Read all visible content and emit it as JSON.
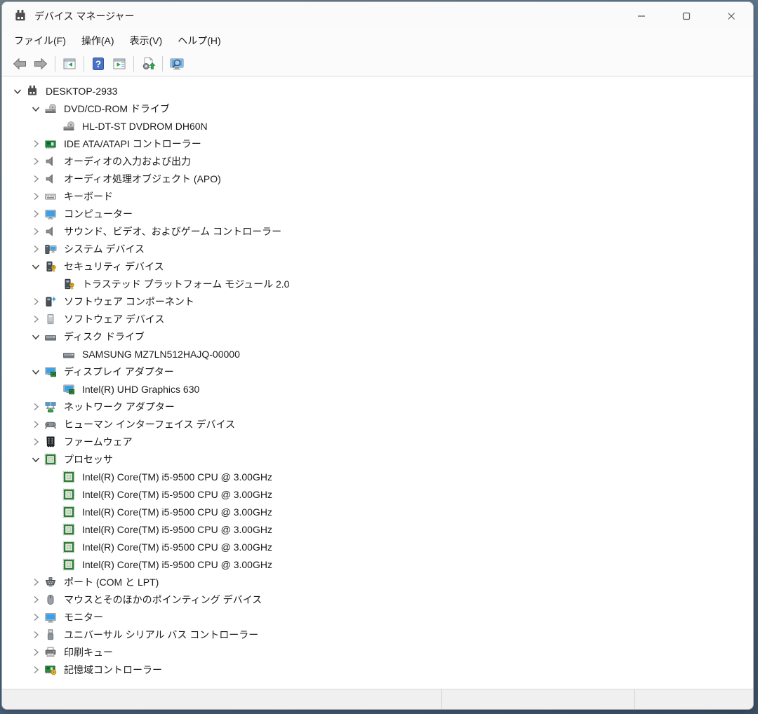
{
  "window": {
    "title": "デバイス マネージャー"
  },
  "menu": {
    "items": [
      {
        "name": "file",
        "label": "ファイル(F)"
      },
      {
        "name": "action",
        "label": "操作(A)"
      },
      {
        "name": "view",
        "label": "表示(V)"
      },
      {
        "name": "help",
        "label": "ヘルプ(H)"
      }
    ]
  },
  "toolbar": {
    "groups": [
      {
        "buttons": [
          {
            "name": "back",
            "icon": "back-icon"
          },
          {
            "name": "forward",
            "icon": "forward-icon"
          }
        ]
      },
      {
        "buttons": [
          {
            "name": "show-hide-console-tree",
            "icon": "console-tree-icon"
          }
        ]
      },
      {
        "buttons": [
          {
            "name": "help",
            "icon": "help-icon"
          },
          {
            "name": "show-hide-action-pane",
            "icon": "action-pane-icon"
          }
        ]
      },
      {
        "buttons": [
          {
            "name": "scan-hardware-changes",
            "icon": "scan-hardware-icon"
          }
        ]
      },
      {
        "buttons": [
          {
            "name": "search-devices",
            "icon": "search-devices-icon"
          }
        ]
      }
    ]
  },
  "tree": {
    "items": [
      {
        "level": 0,
        "state": "expanded",
        "icon": "computer-icon",
        "label": "DESKTOP-2933"
      },
      {
        "level": 1,
        "state": "expanded",
        "icon": "dvd-drive-icon",
        "label": "DVD/CD-ROM ドライブ"
      },
      {
        "level": 2,
        "state": "leaf",
        "icon": "dvd-drive-icon",
        "label": "HL-DT-ST DVDROM DH60N"
      },
      {
        "level": 1,
        "state": "collapsed",
        "icon": "ide-controller-icon",
        "label": "IDE ATA/ATAPI コントローラー"
      },
      {
        "level": 1,
        "state": "collapsed",
        "icon": "audio-icon",
        "label": "オーディオの入力および出力"
      },
      {
        "level": 1,
        "state": "collapsed",
        "icon": "audio-icon",
        "label": "オーディオ処理オブジェクト (APO)"
      },
      {
        "level": 1,
        "state": "collapsed",
        "icon": "keyboard-icon",
        "label": "キーボード"
      },
      {
        "level": 1,
        "state": "collapsed",
        "icon": "monitor-icon",
        "label": "コンピューター"
      },
      {
        "level": 1,
        "state": "collapsed",
        "icon": "audio-icon",
        "label": "サウンド、ビデオ、およびゲーム コントローラー"
      },
      {
        "level": 1,
        "state": "collapsed",
        "icon": "system-devices-icon",
        "label": "システム デバイス"
      },
      {
        "level": 1,
        "state": "expanded",
        "icon": "security-icon",
        "label": "セキュリティ デバイス"
      },
      {
        "level": 2,
        "state": "leaf",
        "icon": "security-icon",
        "label": "トラステッド プラットフォーム モジュール 2.0"
      },
      {
        "level": 1,
        "state": "collapsed",
        "icon": "software-component-icon",
        "label": "ソフトウェア コンポーネント"
      },
      {
        "level": 1,
        "state": "collapsed",
        "icon": "software-device-icon",
        "label": "ソフトウェア デバイス"
      },
      {
        "level": 1,
        "state": "expanded",
        "icon": "disk-drive-icon",
        "label": "ディスク ドライブ"
      },
      {
        "level": 2,
        "state": "leaf",
        "icon": "disk-drive-icon",
        "label": "SAMSUNG MZ7LN512HAJQ-00000"
      },
      {
        "level": 1,
        "state": "expanded",
        "icon": "display-adapter-icon",
        "label": "ディスプレイ アダプター"
      },
      {
        "level": 2,
        "state": "leaf",
        "icon": "display-adapter-icon",
        "label": "Intel(R) UHD Graphics 630"
      },
      {
        "level": 1,
        "state": "collapsed",
        "icon": "network-adapter-icon",
        "label": "ネットワーク アダプター"
      },
      {
        "level": 1,
        "state": "collapsed",
        "icon": "hid-icon",
        "label": "ヒューマン インターフェイス デバイス"
      },
      {
        "level": 1,
        "state": "collapsed",
        "icon": "firmware-icon",
        "label": "ファームウェア"
      },
      {
        "level": 1,
        "state": "expanded",
        "icon": "processor-icon",
        "label": "プロセッサ"
      },
      {
        "level": 2,
        "state": "leaf",
        "icon": "processor-icon",
        "label": "Intel(R) Core(TM) i5-9500 CPU @ 3.00GHz"
      },
      {
        "level": 2,
        "state": "leaf",
        "icon": "processor-icon",
        "label": "Intel(R) Core(TM) i5-9500 CPU @ 3.00GHz"
      },
      {
        "level": 2,
        "state": "leaf",
        "icon": "processor-icon",
        "label": "Intel(R) Core(TM) i5-9500 CPU @ 3.00GHz"
      },
      {
        "level": 2,
        "state": "leaf",
        "icon": "processor-icon",
        "label": "Intel(R) Core(TM) i5-9500 CPU @ 3.00GHz"
      },
      {
        "level": 2,
        "state": "leaf",
        "icon": "processor-icon",
        "label": "Intel(R) Core(TM) i5-9500 CPU @ 3.00GHz"
      },
      {
        "level": 2,
        "state": "leaf",
        "icon": "processor-icon",
        "label": "Intel(R) Core(TM) i5-9500 CPU @ 3.00GHz"
      },
      {
        "level": 1,
        "state": "collapsed",
        "icon": "ports-icon",
        "label": "ポート (COM と LPT)"
      },
      {
        "level": 1,
        "state": "collapsed",
        "icon": "mouse-icon",
        "label": "マウスとそのほかのポインティング デバイス"
      },
      {
        "level": 1,
        "state": "collapsed",
        "icon": "monitor-icon",
        "label": "モニター"
      },
      {
        "level": 1,
        "state": "collapsed",
        "icon": "usb-icon",
        "label": "ユニバーサル シリアル バス コントローラー"
      },
      {
        "level": 1,
        "state": "collapsed",
        "icon": "print-queue-icon",
        "label": "印刷キュー"
      },
      {
        "level": 1,
        "state": "collapsed",
        "icon": "storage-controller-icon",
        "label": "記憶域コントローラー"
      }
    ]
  },
  "statusbar": {
    "sections": [
      "",
      "",
      ""
    ]
  },
  "colors": {
    "help_blue": "#4a72c4",
    "board_green": "#1f8b3e",
    "cpu_green": "#2e7d32",
    "key_gold": "#e2b32a",
    "screen_blue": "#3aa0e8",
    "arrow_green": "#2ea84a"
  }
}
